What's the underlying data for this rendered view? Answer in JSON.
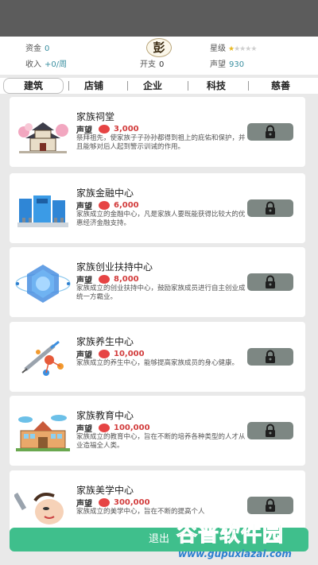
{
  "stats": {
    "funds_label": "资金",
    "funds_value": "0",
    "income_label": "收入",
    "income_value": "+0/周",
    "avatar_char": "彭",
    "expense_label": "开支",
    "expense_value": "0",
    "star_label": "星级",
    "star_level": 1,
    "star_max": 5,
    "prestige_label": "声望",
    "prestige_value": "930"
  },
  "tabs": [
    "建筑",
    "店铺",
    "企业",
    "科技",
    "慈善"
  ],
  "active_tab": 0,
  "rep_label": "声望",
  "items": [
    {
      "name": "家族祠堂",
      "cost": "3,000",
      "desc": "祭拜祖先，使家族子子孙孙都得到祖上的庇佑和保护，并且能够对后人起到警示训诫的作用。",
      "icon": "ancestral-hall-icon"
    },
    {
      "name": "家族金融中心",
      "cost": "6,000",
      "desc": "家族成立的金融中心，凡是家族人要既能获得比较大的优惠经济金融支持。",
      "icon": "bank-building-icon"
    },
    {
      "name": "家族创业扶持中心",
      "cost": "8,000",
      "desc": "家族成立的创业扶持中心，鼓励家族成员进行自主创业成统一方霸业。",
      "icon": "globe-hexagon-icon"
    },
    {
      "name": "家族养生中心",
      "cost": "10,000",
      "desc": "家族成立的养生中心，能够提高家族成员的身心健康。",
      "icon": "syringe-molecule-icon"
    },
    {
      "name": "家族教育中心",
      "cost": "100,000",
      "desc": "家族成立的教育中心，旨在不断的培养各种类型的人才从业造福全人类。",
      "icon": "school-building-icon"
    },
    {
      "name": "家族美学中心",
      "cost": "300,000",
      "desc": "家族成立的美学中心，旨在不断的提高个人",
      "icon": "beauty-face-icon"
    }
  ],
  "exit_label": "退出",
  "watermark": {
    "top": "谷普软件园",
    "bottom": "www.gupuxiazai.com"
  },
  "colors": {
    "accent": "#3fbf8c",
    "cost": "#d23c3c",
    "lock_button": "#7d8783",
    "value": "#3a8fa0"
  }
}
